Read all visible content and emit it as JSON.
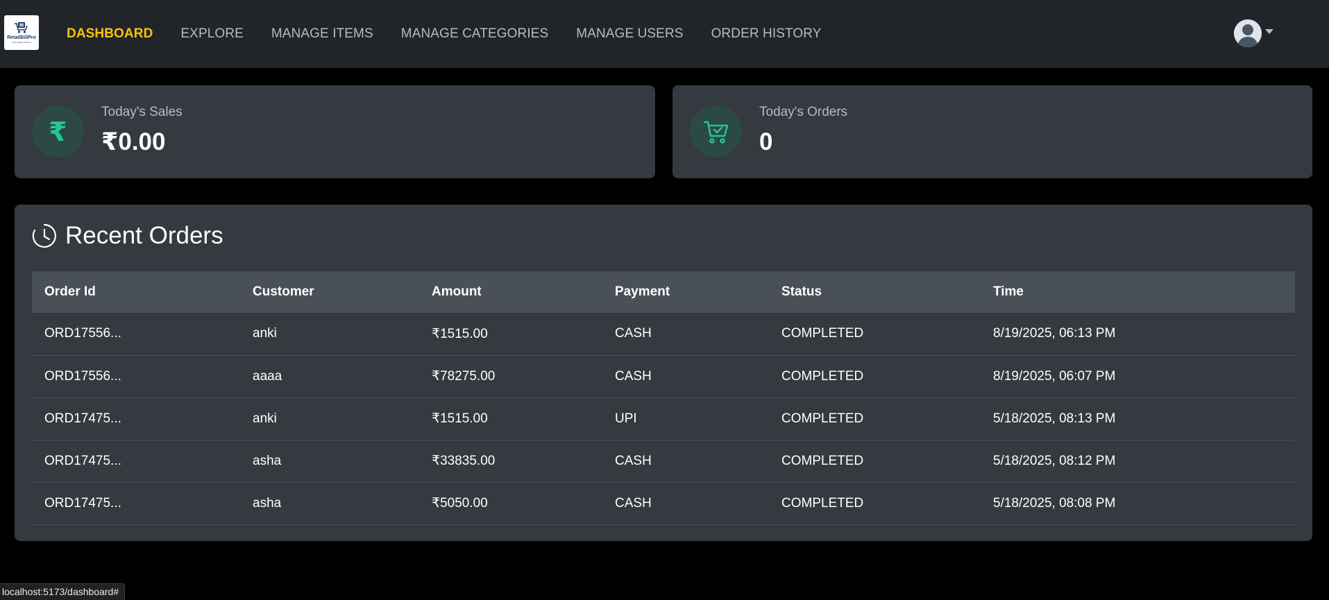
{
  "app": {
    "logo": {
      "brand": "RetailBillPro",
      "tagline": "Smart Billing Solution"
    },
    "nav": [
      {
        "label": "DASHBOARD",
        "active": true
      },
      {
        "label": "EXPLORE",
        "active": false
      },
      {
        "label": "MANAGE ITEMS",
        "active": false
      },
      {
        "label": "MANAGE CATEGORIES",
        "active": false
      },
      {
        "label": "MANAGE USERS",
        "active": false
      },
      {
        "label": "ORDER HISTORY",
        "active": false
      }
    ],
    "user_menu": {
      "icon": "user-avatar-icon"
    }
  },
  "stats": {
    "sales": {
      "label": "Today's Sales",
      "value": "₹0.00",
      "icon": "rupee-icon"
    },
    "orders": {
      "label": "Today's Orders",
      "value": "0",
      "icon": "cart-check-icon"
    }
  },
  "recent_orders": {
    "title": "Recent Orders",
    "icon": "clock-history-icon",
    "columns": [
      "Order Id",
      "Customer",
      "Amount",
      "Payment",
      "Status",
      "Time"
    ],
    "rows": [
      [
        "ORD17556...",
        "anki",
        "₹1515.00",
        "CASH",
        "COMPLETED",
        "8/19/2025, 06:13 PM"
      ],
      [
        "ORD17556...",
        "aaaa",
        "₹78275.00",
        "CASH",
        "COMPLETED",
        "8/19/2025, 06:07 PM"
      ],
      [
        "ORD17475...",
        "anki",
        "₹1515.00",
        "UPI",
        "COMPLETED",
        "5/18/2025, 08:13 PM"
      ],
      [
        "ORD17475...",
        "asha",
        "₹33835.00",
        "CASH",
        "COMPLETED",
        "5/18/2025, 08:12 PM"
      ],
      [
        "ORD17475...",
        "asha",
        "₹5050.00",
        "CASH",
        "COMPLETED",
        "5/18/2025, 08:08 PM"
      ]
    ]
  },
  "browser": {
    "status_url": "localhost:5173/dashboard#"
  },
  "colors": {
    "navbar_bg": "#212529",
    "card_bg": "#343a40",
    "table_header_bg": "#495057",
    "active_nav": "#ffc107",
    "accent_green": "#20c997"
  }
}
